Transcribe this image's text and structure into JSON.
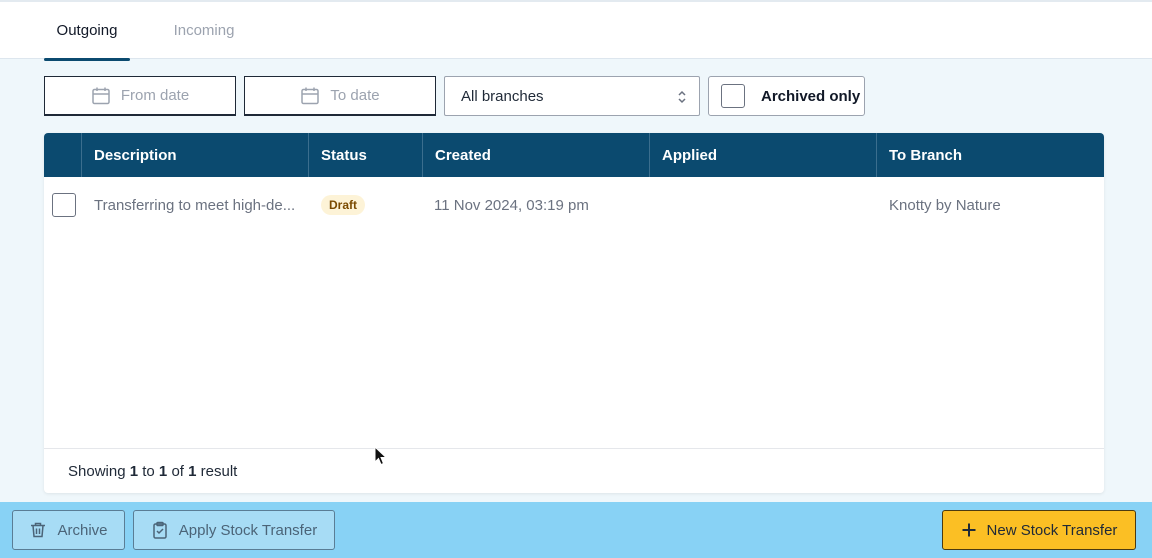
{
  "tabs": [
    {
      "label": "Outgoing",
      "active": true
    },
    {
      "label": "Incoming",
      "active": false
    }
  ],
  "filters": {
    "from_date_placeholder": "From date",
    "to_date_placeholder": "To date",
    "branch_selected": "All branches",
    "archived_label": "Archived only"
  },
  "table": {
    "columns": [
      "Description",
      "Status",
      "Created",
      "Applied",
      "To Branch"
    ],
    "rows": [
      {
        "description": "Transferring to meet high-de...",
        "status": "Draft",
        "created": "11 Nov 2024, 03:19 pm",
        "applied": "",
        "to_branch": "Knotty by Nature"
      }
    ],
    "footer": {
      "prefix": "Showing",
      "start": "1",
      "to_word": "to",
      "end": "1",
      "of_word": "of",
      "total": "1",
      "suffix": "result"
    }
  },
  "actions": {
    "archive_label": "Archive",
    "apply_label": "Apply Stock Transfer",
    "new_label": "New Stock Transfer"
  },
  "colors": {
    "header": "#0b4a6f",
    "primary_button": "#fbbf24",
    "action_bar": "#88d2f5",
    "draft_badge_bg": "#fdf3d7"
  },
  "icons": [
    "calendar-icon",
    "chevron-updown-icon",
    "trash-icon",
    "clipboard-check-icon",
    "plus-icon",
    "cursor-icon"
  ]
}
